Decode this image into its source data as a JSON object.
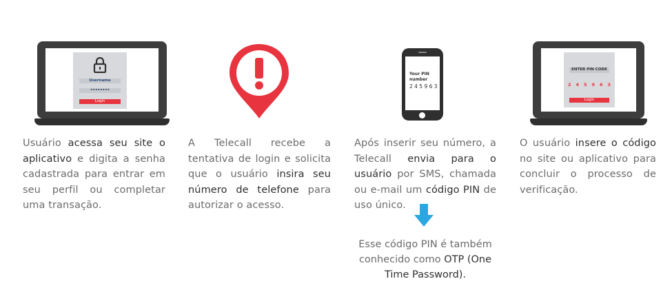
{
  "steps": [
    {
      "screen": {
        "username_label": "Username",
        "password_mask": "••••••••",
        "button_label": "Login"
      },
      "text": [
        "Usuário ",
        "acessa seu site o aplicativo",
        " e digita a senha cadastrada para entrar em seu perfil ou completar uma transação."
      ]
    },
    {
      "text": [
        "A Telecall recebe a tentativa de login e solicita que o usuário ",
        "insira seu número de telefone",
        " para autorizar o acesso."
      ]
    },
    {
      "screen": {
        "line1": "Your PIN",
        "line2": "number",
        "pin": "2 4 5 9 6 3"
      },
      "text": [
        "Após inserir seu número, a Telecall ",
        "envia para o usuário",
        " por SMS, chamada ou e-mail um ",
        "código PIN",
        " de uso único."
      ]
    },
    {
      "screen": {
        "header": "ENTER PIN CODE",
        "digits": [
          "2",
          "4",
          "5",
          "9",
          "6",
          "3"
        ],
        "button_label": "Login"
      },
      "text": [
        "O usuário ",
        "insere o código",
        " no site ou aplicativo para concluir o processo de verificação."
      ]
    }
  ],
  "note": {
    "part1": "Esse código PIN é também conhecido como ",
    "highlight": "OTP (One Time Password).",
    "part2": ""
  },
  "colors": {
    "accent_red": "#e8343f",
    "arrow_blue": "#2aa6e0",
    "device_dark": "#3d3d3d"
  }
}
